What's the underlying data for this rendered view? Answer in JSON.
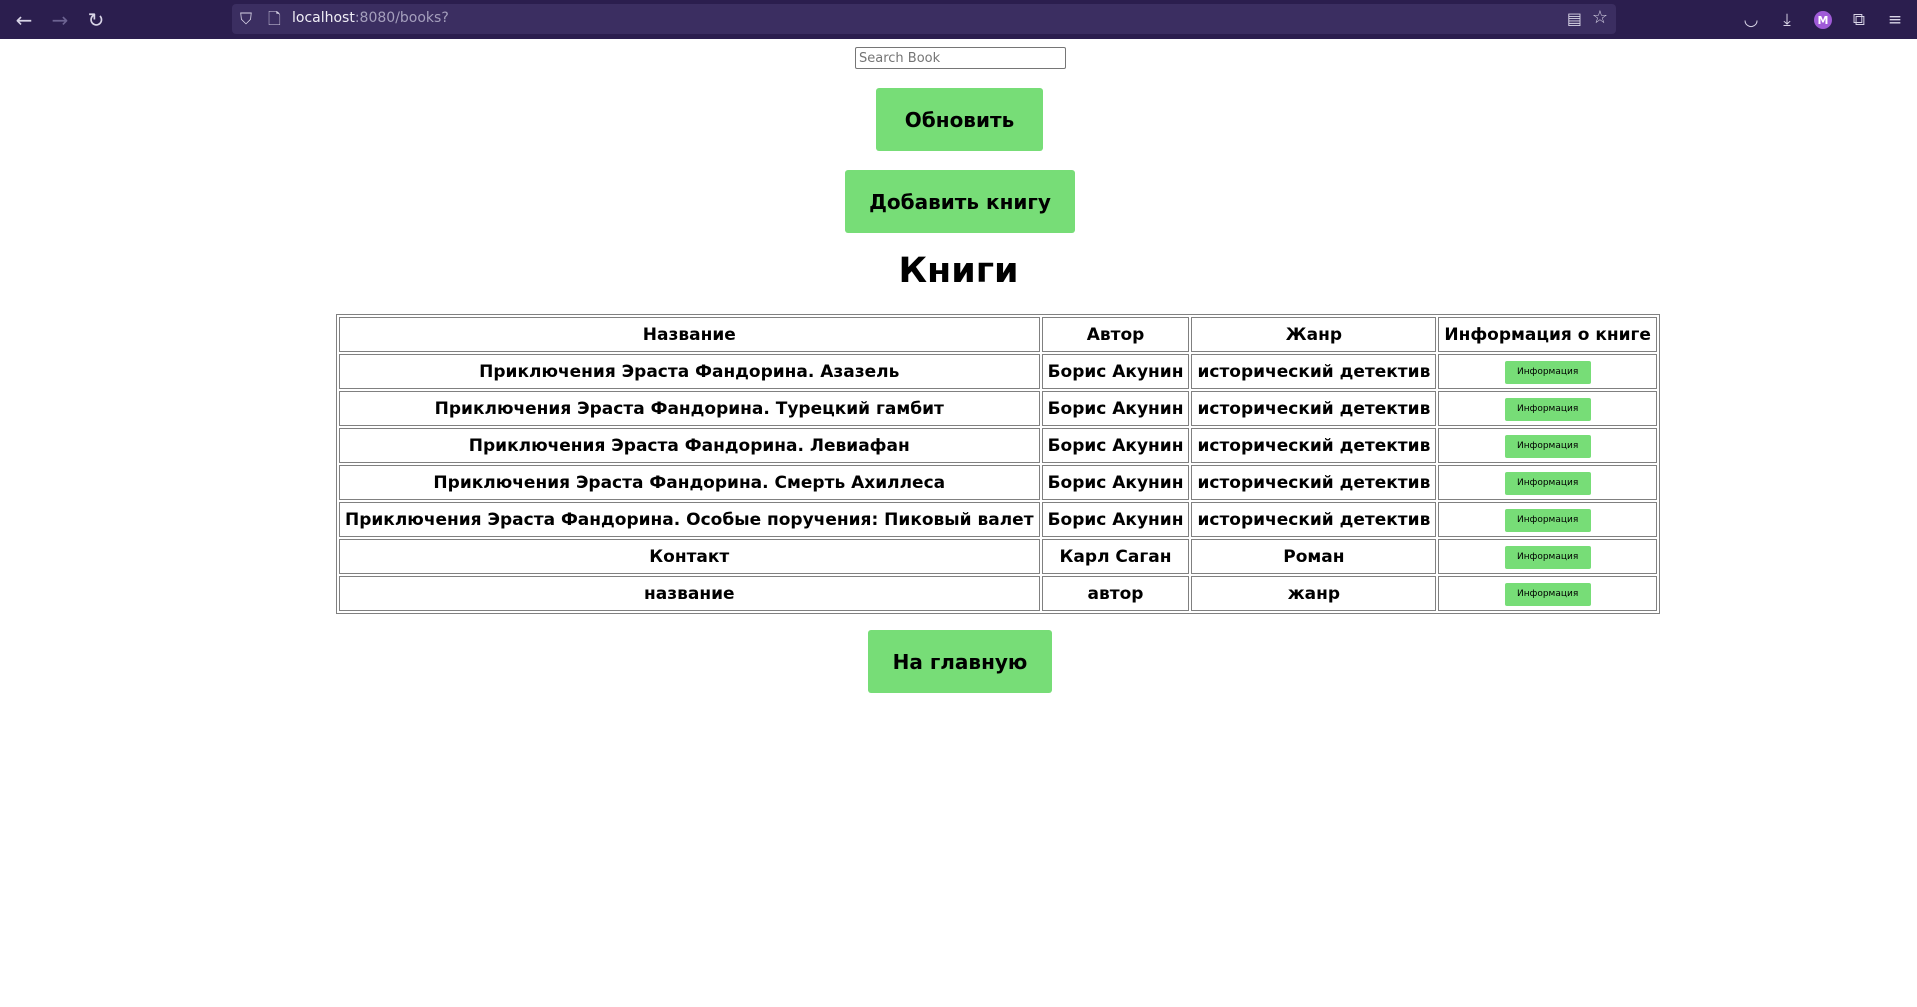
{
  "browser": {
    "url_host": "localhost",
    "url_rest": ":8080/books?",
    "avatar_letter": "M"
  },
  "search": {
    "placeholder": "Search Book",
    "value": ""
  },
  "buttons": {
    "refresh": "Обновить",
    "add_book": "Добавить книгу",
    "home": "На главную"
  },
  "page_title": "Книги",
  "table": {
    "headers": [
      "Название",
      "Автор",
      "Жанр",
      "Информация о книге"
    ],
    "info_label": "Информация",
    "rows": [
      [
        "Приключения Эраста Фандорина. Азазель",
        "Борис Акунин",
        "исторический детектив"
      ],
      [
        "Приключения Эраста Фандорина. Турецкий гамбит",
        "Борис Акунин",
        "исторический детектив"
      ],
      [
        "Приключения Эраста Фандорина. Левиафан",
        "Борис Акунин",
        "исторический детектив"
      ],
      [
        "Приключения Эраста Фандорина. Смерть Ахиллеса",
        "Борис Акунин",
        "исторический детектив"
      ],
      [
        "Приключения Эраста Фандорина. Особые поручения: Пиковый валет",
        "Борис Акунин",
        "исторический детектив"
      ],
      [
        "Контакт",
        "Карл Саган",
        "Роман"
      ],
      [
        "название",
        "автор",
        "жанр"
      ]
    ]
  },
  "colors": {
    "toolbar": "#2b1e4e",
    "button": "#77dd77"
  },
  "icons": {
    "back": "back-arrow-icon",
    "forward": "forward-arrow-icon",
    "reload": "reload-icon",
    "shield": "shield-icon",
    "reader": "reader-view-icon",
    "bookmark": "star-icon",
    "pocket": "pocket-icon",
    "downloads": "download-icon",
    "extensions": "extensions-icon",
    "menu": "hamburger-menu-icon"
  }
}
